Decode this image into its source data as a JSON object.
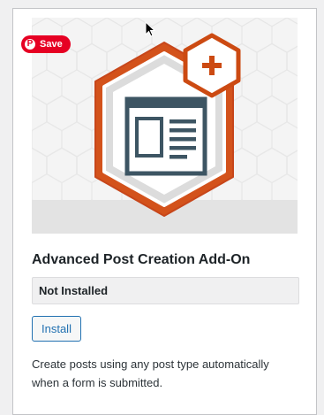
{
  "addon": {
    "title": "Advanced Post Creation Add-On",
    "status": "Not Installed",
    "install_label": "Install",
    "description": "Create posts using any post type automatically when a form is submitted.",
    "icon": "post-window-icon",
    "badge_icon": "plus-icon"
  },
  "pinterest": {
    "save_label": "Save",
    "icon": "pinterest-icon"
  },
  "colors": {
    "accent_orange": "#cc4a12",
    "icon_slate": "#3d5563",
    "button_blue": "#2271b1",
    "pinterest_red": "#e60023"
  }
}
